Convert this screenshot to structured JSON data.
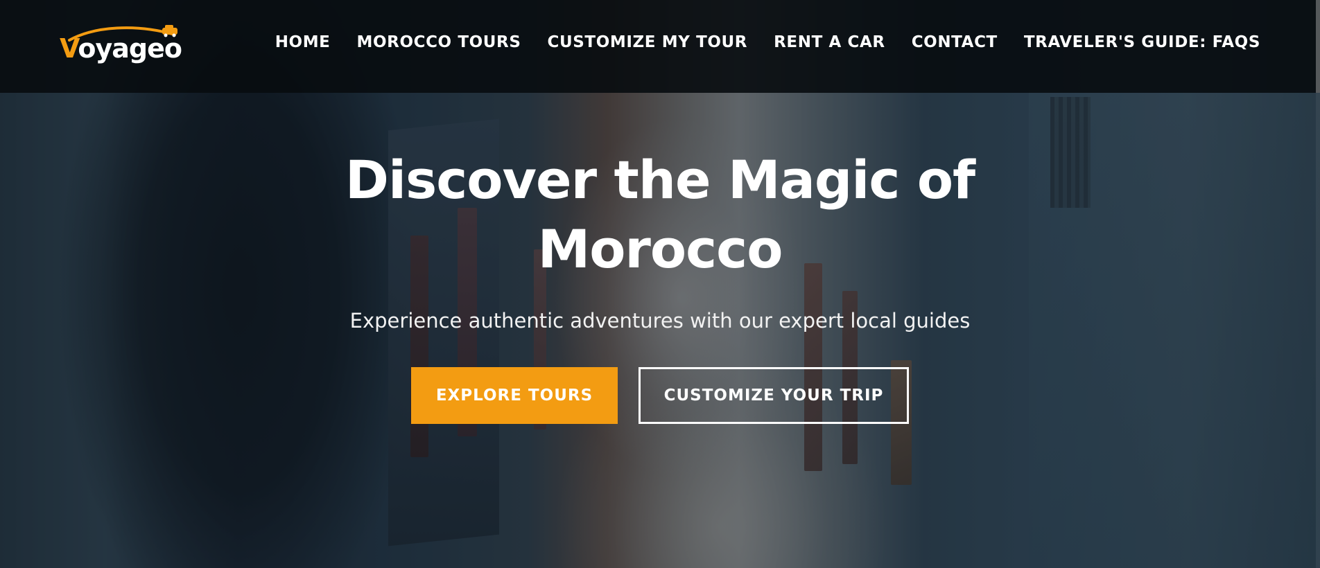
{
  "brand": {
    "name": "Voyageo",
    "accent_color": "#f39c12"
  },
  "nav": {
    "items": [
      {
        "label": "HOME"
      },
      {
        "label": "MOROCCO TOURS"
      },
      {
        "label": "CUSTOMIZE MY TOUR"
      },
      {
        "label": "RENT A CAR"
      },
      {
        "label": "CONTACT"
      },
      {
        "label": "TRAVELER'S GUIDE: FAQS"
      }
    ]
  },
  "hero": {
    "title": "Discover the Magic of Morocco",
    "subtitle": "Experience authentic adventures with our expert local guides",
    "primary_button": "EXPLORE TOURS",
    "secondary_button": "CUSTOMIZE YOUR TRIP"
  },
  "icons": {
    "logo_car": "car-icon"
  }
}
